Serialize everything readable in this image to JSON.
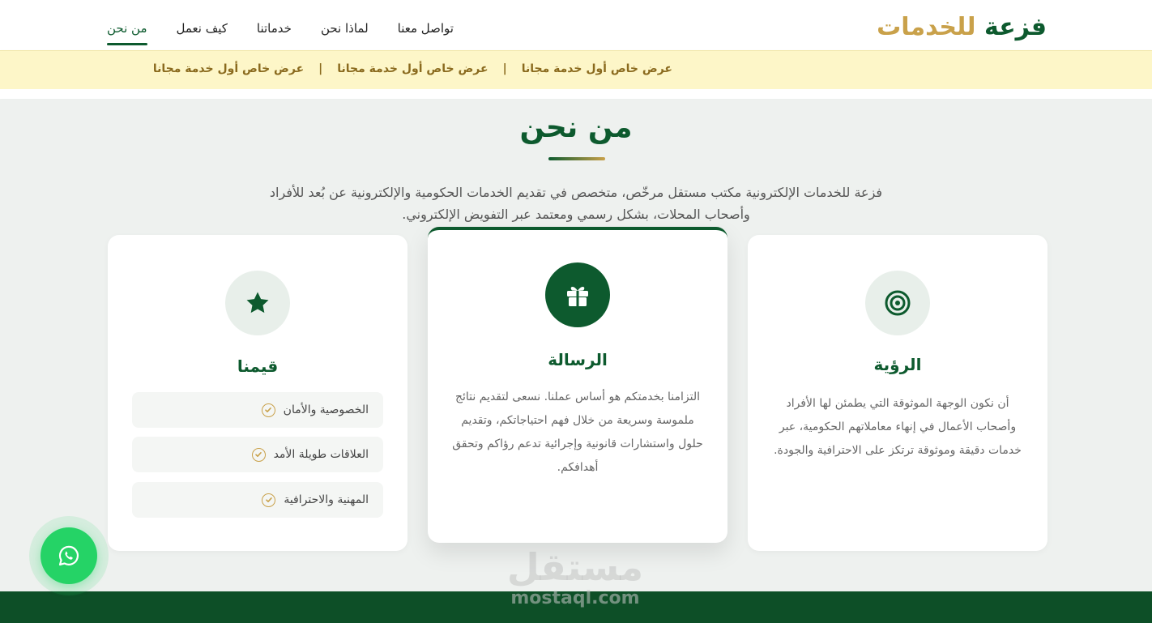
{
  "brand": {
    "part1": "فزعة",
    "part2": "للخدمات"
  },
  "nav": {
    "items": [
      {
        "label": "من نحن"
      },
      {
        "label": "كيف نعمل"
      },
      {
        "label": "خدماتنا"
      },
      {
        "label": "لماذا نحن"
      },
      {
        "label": "تواصل معنا"
      }
    ],
    "active": "من نحن"
  },
  "promo": {
    "items": [
      "عرض خاص أول خدمة مجانا",
      "عرض خاص أول خدمة مجانا",
      "عرض خاص أول خدمة مجانا"
    ],
    "separator": "|"
  },
  "section": {
    "title": "من نحن",
    "intro": "فزعة للخدمات الإلكترونية مكتب مستقل مرخّص، متخصص في تقديم الخدمات الحكومية والإلكترونية عن بُعد للأفراد وأصحاب المحلات، بشكل رسمي ومعتمد عبر التفويض الإلكتروني."
  },
  "cards": {
    "vision": {
      "icon": "target-icon",
      "title": "الرؤية",
      "text": "أن نكون الوجهة الموثوقة التي يطمئن لها الأفراد وأصحاب الأعمال في إنهاء معاملاتهم الحكومية، عبر خدمات دقيقة وموثوقة ترتكز على الاحترافية والجودة."
    },
    "mission": {
      "icon": "gift-icon",
      "title": "الرسالة",
      "text": "التزامنا بخدمتكم هو أساس عملنا. نسعى لتقديم نتائج ملموسة وسريعة من خلال فهم احتياجاتكم، وتقديم حلول واستشارات قانونية وإجرائية تدعم رؤاكم وتحقق أهدافكم."
    },
    "values": {
      "icon": "star-icon",
      "title": "قيمنا",
      "items": [
        "الخصوصية والأمان",
        "العلاقات طويلة الأمد",
        "المهنية والاحترافية"
      ]
    }
  },
  "whatsapp": {
    "icon": "whatsapp-icon"
  },
  "watermark": {
    "arabic": "مستقل",
    "latin": "mostaql.com"
  },
  "colors": {
    "primary": "#0d5a2e",
    "gold": "#c9a14a",
    "promo_bg": "#fdf6c8",
    "page_bg": "#eef1ef",
    "whatsapp": "#25d366",
    "footer": "#0d4f27"
  }
}
